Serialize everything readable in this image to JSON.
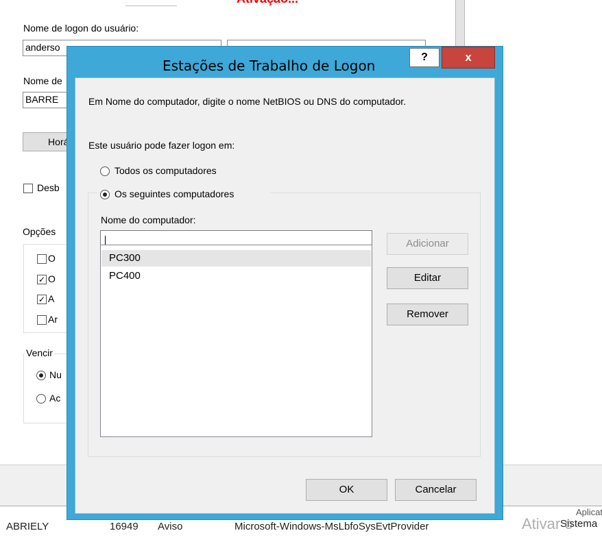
{
  "background": {
    "top_red_text": "Ativação...",
    "logon_name_label": "Nome de logon do usuário:",
    "logon_name_value": "anderso",
    "logon_name2_label": "Nome de",
    "logon_name2_value": "BARRE",
    "hours_button": "Horário",
    "unlock_checkbox": "Desb",
    "options_label": "Opções",
    "options": [
      {
        "text": "O",
        "checked": false
      },
      {
        "text": "O",
        "checked": true
      },
      {
        "text": "A",
        "checked": true
      },
      {
        "text": "Ar",
        "checked": false
      }
    ],
    "expiry_group": "Vencir",
    "expiry_never": "Nu",
    "expiry_at": "Ac",
    "events_row": {
      "name": "ABRIELY",
      "id": "16949",
      "level": "Aviso",
      "source": "Microsoft-Windows-MsLbfoSysEvtProvider",
      "log": "Sistema"
    },
    "partial_right_text": "Aplicati",
    "activate_watermark": "Ativar o"
  },
  "dialog": {
    "title": "Estações de Trabalho de Logon",
    "help_label": "?",
    "close_label": "x",
    "instructions": "Em Nome do computador, digite o nome NetBIOS ou DNS do computador.",
    "logon_to_label": "Este usuário pode fazer logon em:",
    "radio_all": "Todos os computadores",
    "radio_following": "Os seguintes computadores",
    "radio_selected": "following",
    "computer_name_label": "Nome do computador:",
    "computer_name_value": "",
    "buttons": {
      "add": "Adicionar",
      "edit": "Editar",
      "remove": "Remover"
    },
    "computers": [
      "PC300",
      "PC400"
    ],
    "ok_label": "OK",
    "cancel_label": "Cancelar"
  },
  "colors": {
    "dialog_frame": "#3ea8d8",
    "close_button": "#c7453c",
    "client_bg": "#f0f0f0"
  }
}
